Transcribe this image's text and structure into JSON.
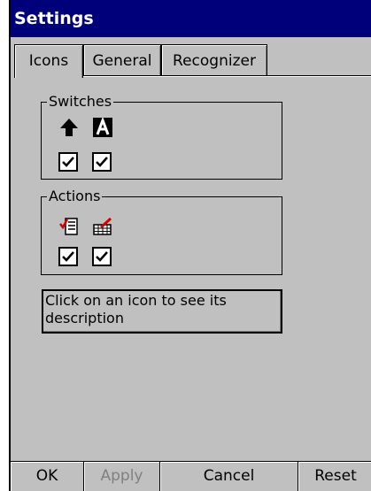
{
  "window": {
    "title": "Settings"
  },
  "tabs": [
    {
      "label": "Icons",
      "active": true
    },
    {
      "label": "General",
      "active": false
    },
    {
      "label": "Recognizer",
      "active": false
    }
  ],
  "switches": {
    "title": "Switches",
    "items": [
      {
        "icon": "shift-arrow-icon",
        "checked": true
      },
      {
        "icon": "caps-a-icon",
        "checked": true
      }
    ]
  },
  "actions": {
    "title": "Actions",
    "items": [
      {
        "icon": "checklist-icon",
        "checked": true
      },
      {
        "icon": "keyboard-pencil-icon",
        "checked": true
      }
    ]
  },
  "description": "Click on an icon to see its description",
  "buttons": [
    {
      "label": "OK",
      "enabled": true
    },
    {
      "label": "Apply",
      "enabled": false
    },
    {
      "label": "Cancel",
      "enabled": true
    },
    {
      "label": "Reset",
      "enabled": true
    }
  ],
  "colors": {
    "titlebar": "#00007b",
    "face": "#c0c0c0",
    "accent_red": "#d40000"
  }
}
